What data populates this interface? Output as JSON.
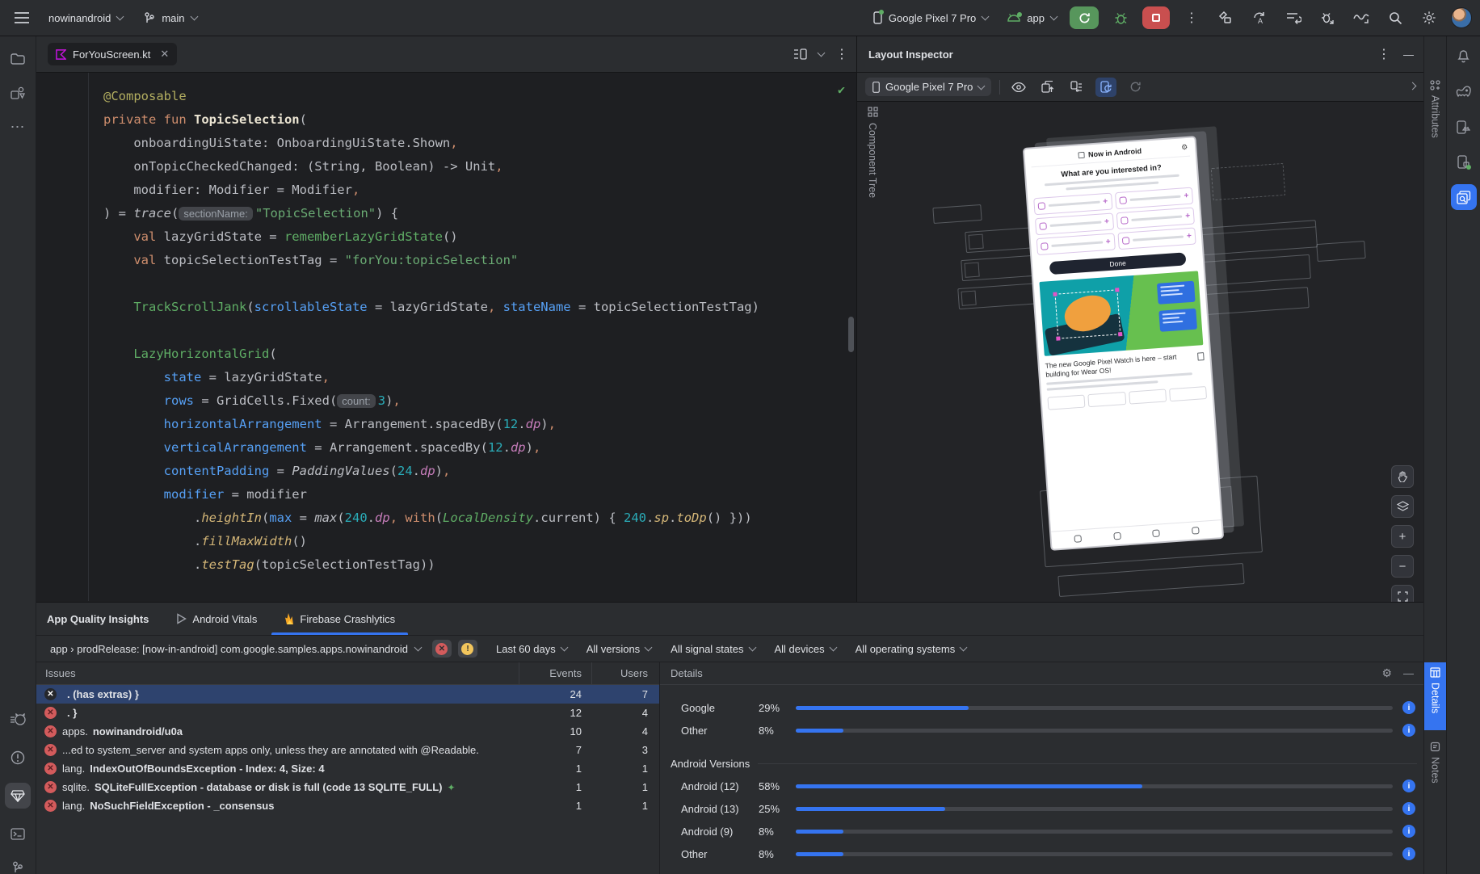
{
  "colors": {
    "accent": "#3574f0",
    "run_green": "#57965c",
    "stop_red": "#c94f4f",
    "error_red": "#d35b5c",
    "warn_yellow": "#f2c55c",
    "selection_blue": "#2e436e"
  },
  "topbar": {
    "project": "nowinandroid",
    "branch": "main",
    "device": "Google Pixel 7 Pro",
    "run_config": "app"
  },
  "editor": {
    "tab": "ForYouScreen.kt",
    "lines": [
      [
        [
          "ann",
          "@Composable"
        ]
      ],
      [
        [
          "kw",
          "private fun "
        ],
        [
          "fn",
          "TopicSelection"
        ],
        [
          "txt",
          "("
        ]
      ],
      [
        [
          "txt",
          "    onboardingUiState: OnboardingUiState.Shown"
        ],
        [
          "kw",
          ","
        ]
      ],
      [
        [
          "txt",
          "    onTopicCheckedChanged: (String, Boolean) -> Unit"
        ],
        [
          "kw",
          ","
        ]
      ],
      [
        [
          "txt",
          "    modifier: Modifier = Modifier"
        ],
        [
          "kw",
          ","
        ]
      ],
      [
        [
          "txt",
          ") = "
        ],
        [
          "it",
          "trace"
        ],
        [
          "txt",
          "("
        ],
        [
          "hint",
          "sectionName:"
        ],
        [
          "str",
          "\"TopicSelection\""
        ],
        [
          "txt",
          ") {"
        ]
      ],
      [
        [
          "txt",
          "    "
        ],
        [
          "kw",
          "val "
        ],
        [
          "txt",
          "lazyGridState = "
        ],
        [
          "call",
          "rememberLazyGridState"
        ],
        [
          "txt",
          "()"
        ]
      ],
      [
        [
          "txt",
          "    "
        ],
        [
          "kw",
          "val "
        ],
        [
          "txt",
          "topicSelectionTestTag = "
        ],
        [
          "str",
          "\"forYou:topicSelection\""
        ]
      ],
      [],
      [
        [
          "txt",
          "    "
        ],
        [
          "call",
          "TrackScrollJank"
        ],
        [
          "txt",
          "("
        ],
        [
          "param",
          "scrollableState"
        ],
        [
          "txt",
          " = lazyGridState"
        ],
        [
          "kw",
          ","
        ],
        [
          "txt",
          " "
        ],
        [
          "param",
          "stateName"
        ],
        [
          "txt",
          " = topicSelectionTestTag)"
        ]
      ],
      [],
      [
        [
          "txt",
          "    "
        ],
        [
          "call",
          "LazyHorizontalGrid"
        ],
        [
          "txt",
          "("
        ]
      ],
      [
        [
          "txt",
          "        "
        ],
        [
          "param",
          "state"
        ],
        [
          "txt",
          " = lazyGridState"
        ],
        [
          "kw",
          ","
        ]
      ],
      [
        [
          "txt",
          "        "
        ],
        [
          "param",
          "rows"
        ],
        [
          "txt",
          " = GridCells.Fixed("
        ],
        [
          "hint",
          "count:"
        ],
        [
          "num",
          "3"
        ],
        [
          "txt",
          ")"
        ],
        [
          "kw",
          ","
        ]
      ],
      [
        [
          "txt",
          "        "
        ],
        [
          "param",
          "horizontalArrangement"
        ],
        [
          "txt",
          " = Arrangement.spacedBy("
        ],
        [
          "num",
          "12"
        ],
        [
          "txt",
          "."
        ],
        [
          "prop",
          "dp"
        ],
        [
          "txt",
          ")"
        ],
        [
          "kw",
          ","
        ]
      ],
      [
        [
          "txt",
          "        "
        ],
        [
          "param",
          "verticalArrangement"
        ],
        [
          "txt",
          " = Arrangement.spacedBy("
        ],
        [
          "num",
          "12"
        ],
        [
          "txt",
          "."
        ],
        [
          "prop",
          "dp"
        ],
        [
          "txt",
          ")"
        ],
        [
          "kw",
          ","
        ]
      ],
      [
        [
          "txt",
          "        "
        ],
        [
          "param",
          "contentPadding"
        ],
        [
          "txt",
          " = "
        ],
        [
          "it",
          "PaddingValues"
        ],
        [
          "txt",
          "("
        ],
        [
          "num",
          "24"
        ],
        [
          "txt",
          "."
        ],
        [
          "prop",
          "dp"
        ],
        [
          "txt",
          ")"
        ],
        [
          "kw",
          ","
        ]
      ],
      [
        [
          "txt",
          "        "
        ],
        [
          "param",
          "modifier"
        ],
        [
          "txt",
          " = modifier"
        ]
      ],
      [
        [
          "txt",
          "            ."
        ],
        [
          "ext",
          "heightIn"
        ],
        [
          "txt",
          "("
        ],
        [
          "param",
          "max"
        ],
        [
          "txt",
          " = "
        ],
        [
          "it",
          "max"
        ],
        [
          "txt",
          "("
        ],
        [
          "num",
          "240"
        ],
        [
          "txt",
          "."
        ],
        [
          "prop",
          "dp"
        ],
        [
          "kw",
          ","
        ],
        [
          "txt",
          " "
        ],
        [
          "kw",
          "with"
        ],
        [
          "txt",
          "("
        ],
        [
          "itg",
          "LocalDensity"
        ],
        [
          "txt",
          ".current) { "
        ],
        [
          "num",
          "240"
        ],
        [
          "txt",
          "."
        ],
        [
          "ext",
          "sp"
        ],
        [
          "txt",
          "."
        ],
        [
          "ext",
          "toDp"
        ],
        [
          "txt",
          "() }))"
        ]
      ],
      [
        [
          "txt",
          "            ."
        ],
        [
          "ext",
          "fillMaxWidth"
        ],
        [
          "txt",
          "()"
        ]
      ],
      [
        [
          "txt",
          "            ."
        ],
        [
          "ext",
          "testTag"
        ],
        [
          "txt",
          "(topicSelectionTestTag))"
        ]
      ]
    ]
  },
  "inspector": {
    "title": "Layout Inspector",
    "device": "Google Pixel 7 Pro",
    "component_tree_label": "Component Tree",
    "attributes_label": "Attributes",
    "phone": {
      "app_title": "Now in Android",
      "question": "What are you interested in?",
      "done": "Done",
      "promo": "The new Google Pixel Watch is here – start building for Wear OS!"
    }
  },
  "aqi": {
    "title": "App Quality Insights",
    "tabs": [
      "Android Vitals",
      "Firebase Crashlytics"
    ],
    "module_filter": "app › prodRelease: [now-in-android] com.google.samples.apps.nowinandroid",
    "filters": [
      "Last 60 days",
      "All versions",
      "All signal states",
      "All devices",
      "All operating systems"
    ],
    "columns": {
      "issues": "Issues",
      "events": "Events",
      "users": "Users"
    },
    "issues": [
      {
        "prefix": "",
        "title": ". (has extras) }",
        "events": 24,
        "users": 7,
        "selected": true
      },
      {
        "prefix": "",
        "title": ". }",
        "events": 12,
        "users": 4
      },
      {
        "prefix": "apps.",
        "title": "nowinandroid/u0a",
        "events": 10,
        "users": 4
      },
      {
        "prefix": "...ed to system_server and system apps only, unless they are annotated with @Readable.",
        "title": "",
        "events": 7,
        "users": 3
      },
      {
        "prefix": "lang.",
        "title": "IndexOutOfBoundsException - Index: 4, Size: 4",
        "events": 1,
        "users": 1
      },
      {
        "prefix": "sqlite.",
        "title": "SQLiteFullException - database or disk is full (code 13 SQLITE_FULL)",
        "events": 1,
        "users": 1,
        "sparkle": true
      },
      {
        "prefix": "lang.",
        "title": "NoSuchFieldException - _consensus",
        "events": 1,
        "users": 1
      }
    ],
    "details": {
      "title": "Details",
      "devices": [
        {
          "label": "Google",
          "pct": 29
        },
        {
          "label": "Other",
          "pct": 8
        }
      ],
      "versions_title": "Android Versions",
      "versions": [
        {
          "label": "Android (12)",
          "pct": 58
        },
        {
          "label": "Android (13)",
          "pct": 25
        },
        {
          "label": "Android (9)",
          "pct": 8
        },
        {
          "label": "Other",
          "pct": 8
        }
      ],
      "side_tabs": [
        "Details",
        "Notes"
      ]
    }
  }
}
